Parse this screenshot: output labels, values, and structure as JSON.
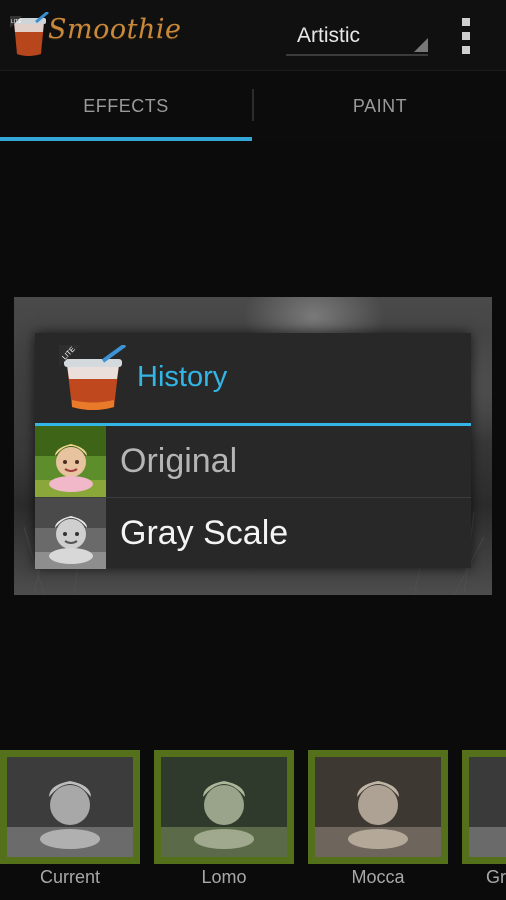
{
  "app": {
    "logo_text": "Smoothie",
    "logo_badge": "LITE"
  },
  "toolbar": {
    "mode_selected": "Artistic"
  },
  "tabs": [
    {
      "label": "EFFECTS",
      "active": true
    },
    {
      "label": "PAINT",
      "active": false
    }
  ],
  "dialog": {
    "title": "History",
    "icon_badge": "LITE",
    "items": [
      {
        "label": "Original",
        "style": "color"
      },
      {
        "label": "Gray Scale",
        "style": "grayscale"
      }
    ]
  },
  "filmstrip": {
    "items": [
      {
        "label": "Current"
      },
      {
        "label": "Lomo"
      },
      {
        "label": "Mocca"
      },
      {
        "label": "Gr"
      }
    ]
  },
  "colors": {
    "accent": "#33b5e5",
    "frame": "#55701a",
    "logo": "#c8893a"
  }
}
